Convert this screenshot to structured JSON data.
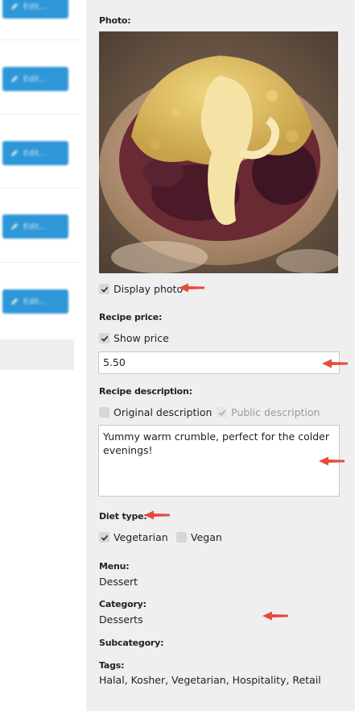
{
  "left_list": {
    "edit_label": "Edit..."
  },
  "form": {
    "photo_label": "Photo:",
    "display_photo_label": "Display photo",
    "display_photo_checked": true,
    "price_label": "Recipe price:",
    "show_price_label": "Show price",
    "show_price_checked": true,
    "price_value": "5.50",
    "description_label": "Recipe description:",
    "original_description_label": "Original description",
    "original_description_checked": false,
    "public_description_label": "Public description",
    "public_description_checked": true,
    "description_value": "Yummy warm crumble, perfect for the colder evenings!",
    "diet_type_label": "Diet type:",
    "vegetarian_label": "Vegetarian",
    "vegetarian_checked": true,
    "vegan_label": "Vegan",
    "vegan_checked": false,
    "menu_label": "Menu:",
    "menu_value": "Dessert",
    "category_label": "Category:",
    "category_value": "Desserts",
    "subcategory_label": "Subcategory:",
    "tags_label": "Tags:",
    "tags_value": "Halal, Kosher, Vegetarian, Hospitality, Retail"
  },
  "colors": {
    "panel_bg": "#efefef",
    "edit_button": "#2f97d8",
    "annotation_arrow": "#e64b3c"
  },
  "icons": [
    "pencil-icon",
    "check-icon",
    "arrow-annotation-icon"
  ]
}
